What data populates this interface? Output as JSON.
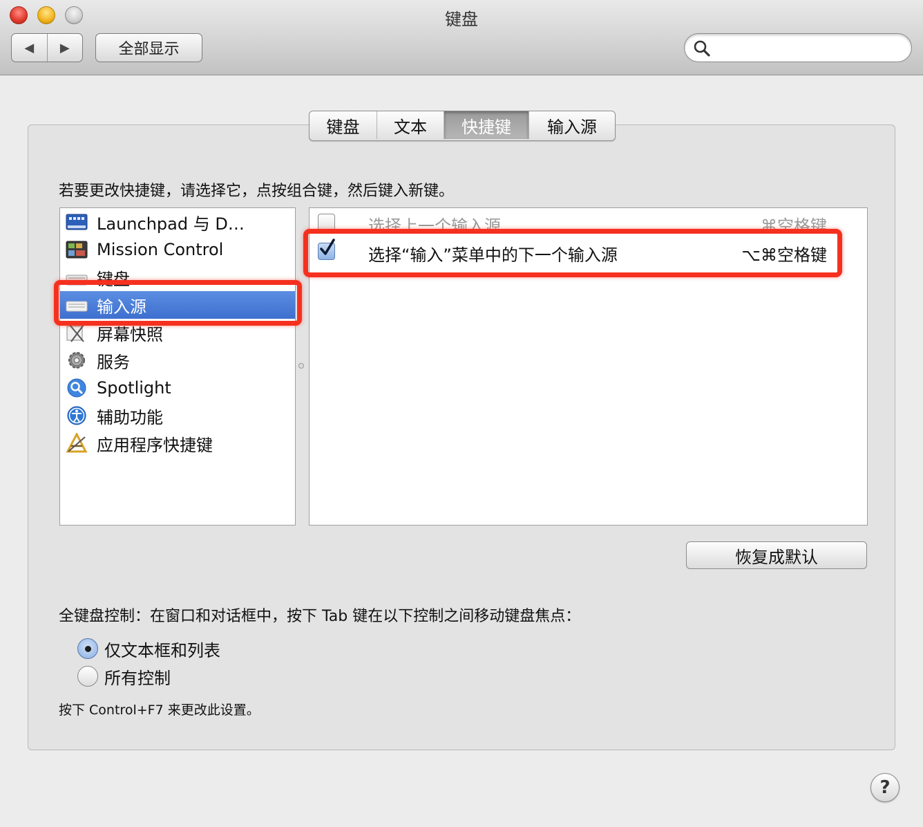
{
  "window": {
    "title": "键盘"
  },
  "toolbar": {
    "back_glyph": "◀",
    "forward_glyph": "▶",
    "show_all": "全部显示",
    "search_placeholder": ""
  },
  "tabs": [
    {
      "label": "键盘",
      "active": false
    },
    {
      "label": "文本",
      "active": false
    },
    {
      "label": "快捷键",
      "active": true
    },
    {
      "label": "输入源",
      "active": false
    }
  ],
  "instruction": "若要更改快捷键，请选择它，点按组合键，然后键入新键。",
  "categories": [
    {
      "label": "Launchpad 与 D…",
      "icon": "launchpad-icon",
      "selected": false
    },
    {
      "label": "Mission Control",
      "icon": "mission-control-icon",
      "selected": false
    },
    {
      "label": "键盘",
      "icon": "keyboard-icon",
      "selected": false
    },
    {
      "label": "输入源",
      "icon": "keyboard-icon",
      "selected": true
    },
    {
      "label": "屏幕快照",
      "icon": "screenshot-icon",
      "selected": false
    },
    {
      "label": "服务",
      "icon": "gear-icon",
      "selected": false
    },
    {
      "label": "Spotlight",
      "icon": "spotlight-icon",
      "selected": false
    },
    {
      "label": "辅助功能",
      "icon": "accessibility-icon",
      "selected": false
    },
    {
      "label": "应用程序快捷键",
      "icon": "app-shortcuts-icon",
      "selected": false
    }
  ],
  "shortcuts": [
    {
      "label": "选择上一个输入源",
      "keys": "⌘空格键",
      "checked": false,
      "dimmed": true
    },
    {
      "label": "选择“输入”菜单中的下一个输入源",
      "keys": "⌥⌘空格键",
      "checked": true,
      "dimmed": false
    }
  ],
  "restore_defaults": "恢复成默认",
  "full_keyboard_access": {
    "label": "全键盘控制：在窗口和对话框中，按下 Tab 键在以下控制之间移动键盘焦点：",
    "options": [
      {
        "label": "仅文本框和列表",
        "selected": true
      },
      {
        "label": "所有控制",
        "selected": false
      }
    ],
    "hint": "按下 Control+F7 来更改此设置。"
  },
  "help_label": "?",
  "colors": {
    "highlight_red": "#f5301e",
    "selection_blue": "#3e6fcf"
  }
}
